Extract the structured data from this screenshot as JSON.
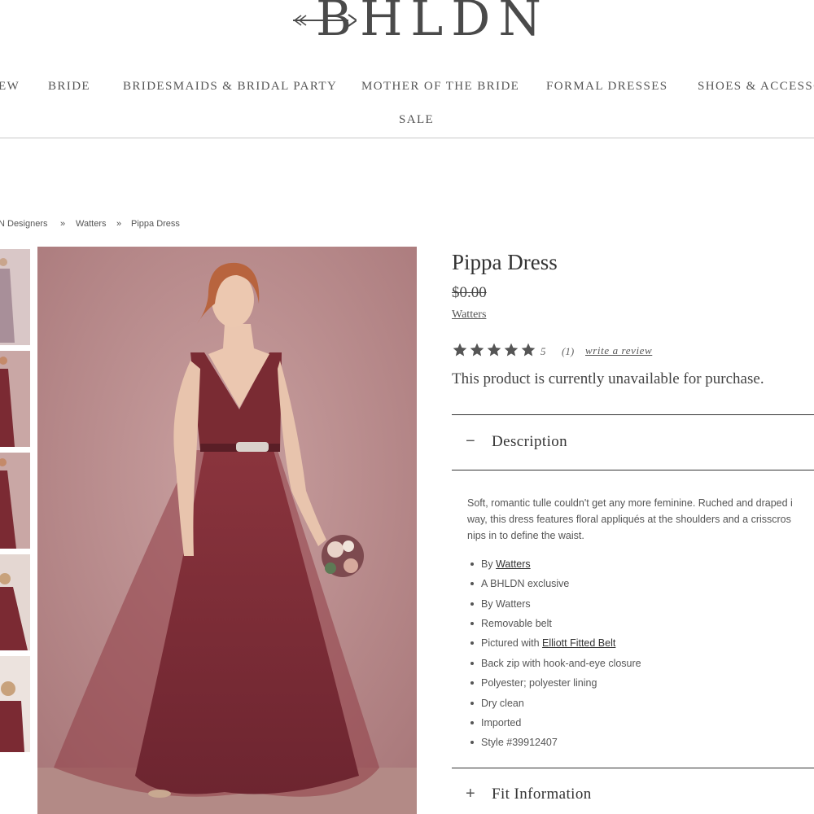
{
  "brand": {
    "logo_text": "BHLDN"
  },
  "nav": {
    "items": [
      "EW",
      "BRIDE",
      "BRIDESMAIDS & BRIDAL PARTY",
      "MOTHER OF THE BRIDE",
      "FORMAL DRESSES",
      "SHOES & ACCESSO"
    ],
    "sale": "SALE"
  },
  "breadcrumb": {
    "items": [
      "N Designers",
      "Watters",
      "Pippa Dress"
    ],
    "separator": "»"
  },
  "product": {
    "title": "Pippa Dress",
    "price": "$0.00",
    "designer": "Watters",
    "rating": {
      "stars": 5,
      "value": "5",
      "count": "(1)",
      "review_link": "write a review"
    },
    "availability": "This product is currently unavailable for purchase.",
    "description_heading": "Description",
    "description_toggle": "−",
    "description_lines": [
      "Soft, romantic tulle couldn't get any more feminine. Ruched and draped i",
      "way, this dress features floral appliqués at the shoulders and a crisscros",
      "nips in to define the waist."
    ],
    "features": [
      {
        "prefix": "By ",
        "link": "Watters"
      },
      {
        "prefix": "A BHLDN exclusive",
        "link": ""
      },
      {
        "prefix": "By Watters",
        "link": ""
      },
      {
        "prefix": "Removable belt",
        "link": ""
      },
      {
        "prefix": "Pictured with ",
        "link": "Elliott Fitted Belt"
      },
      {
        "prefix": "Back zip with hook-and-eye closure",
        "link": ""
      },
      {
        "prefix": "Polyester; polyester lining",
        "link": ""
      },
      {
        "prefix": "Dry clean",
        "link": ""
      },
      {
        "prefix": "Imported",
        "link": ""
      },
      {
        "prefix": "Style #39912407",
        "link": ""
      }
    ],
    "fit_heading": "Fit Information",
    "fit_toggle": "+"
  },
  "colors": {
    "dress": "#7a2b33",
    "wall": "#b9898a",
    "text": "#444444",
    "star": "#555555"
  },
  "icons": [
    "arrow-logo-icon",
    "star-icon",
    "minus-icon",
    "plus-icon"
  ]
}
